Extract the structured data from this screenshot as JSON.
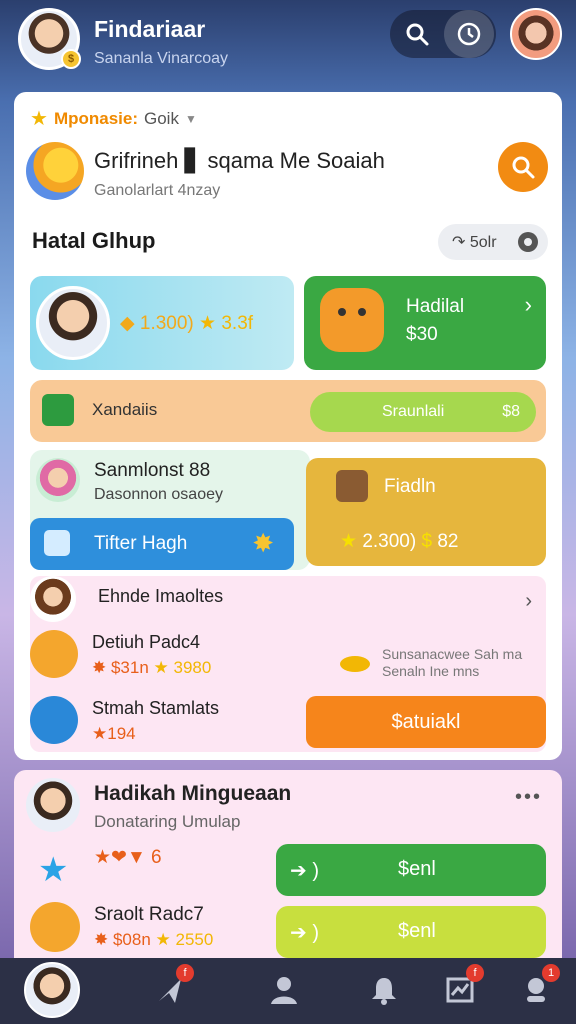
{
  "header": {
    "app_title": "Findariaar",
    "app_subtitle": "Sananla Vinarcoay",
    "avatar_badge": "$"
  },
  "category": {
    "label": "Mponasie:",
    "value": "Goik"
  },
  "featured": {
    "title": "Grifrineh ▋ sqama Me Soaiah",
    "subtitle": "Ganolarlart 4nzay"
  },
  "section": {
    "title": "Hatal Glhup",
    "pill_label": "↷ 5olr"
  },
  "tile_a": {
    "value": "◆ 1.300)",
    "stars": "★ 3.3f"
  },
  "tile_b": {
    "title": "Hadilal",
    "value": "$30"
  },
  "row_c": {
    "label": "Xandaiis",
    "bar_label": "Sraunlali",
    "bar_value": "$8"
  },
  "tile_d": {
    "title": "Sanmlonst 88",
    "subtitle": "Dasonnon osaoey",
    "button_label": "Tifter Hagh"
  },
  "tile_e": {
    "title": "Fiadln",
    "stars": "★",
    "value": "2.300)",
    "coin": "$",
    "count": "82"
  },
  "pink_section": {
    "title": "Ehnde Imaoltes",
    "items": [
      {
        "name": "Detiuh Padc4",
        "value": "✸ $31n",
        "stars": "★ 3980"
      },
      {
        "name": "Stmah Stamlats",
        "value": "★194"
      }
    ],
    "note_line1": "Sunsanacwee Sah",
    "note_suffix": "ma",
    "note_line2": "Senaln Ine mns",
    "button_label": "$atuiakl"
  },
  "card2": {
    "title": "Hadikah Mingueaan",
    "subtitle": "Donataring Umulap",
    "row1_value": "★❤▼ 6",
    "button1": {
      "arrow": "➔ )",
      "label": "$enl"
    },
    "item": {
      "name": "Sraolt Radc7",
      "value": "✸ $08n",
      "stars": "★ 2550"
    },
    "button2": {
      "arrow": "➔ )",
      "label": "$enl"
    }
  },
  "nav": {
    "badges": [
      "f",
      "f",
      "1"
    ]
  },
  "colors": {
    "accent_orange": "#f6851b",
    "green": "#3aa843",
    "blue": "#2e8fdc",
    "pink_bg": "#fde6f3"
  }
}
